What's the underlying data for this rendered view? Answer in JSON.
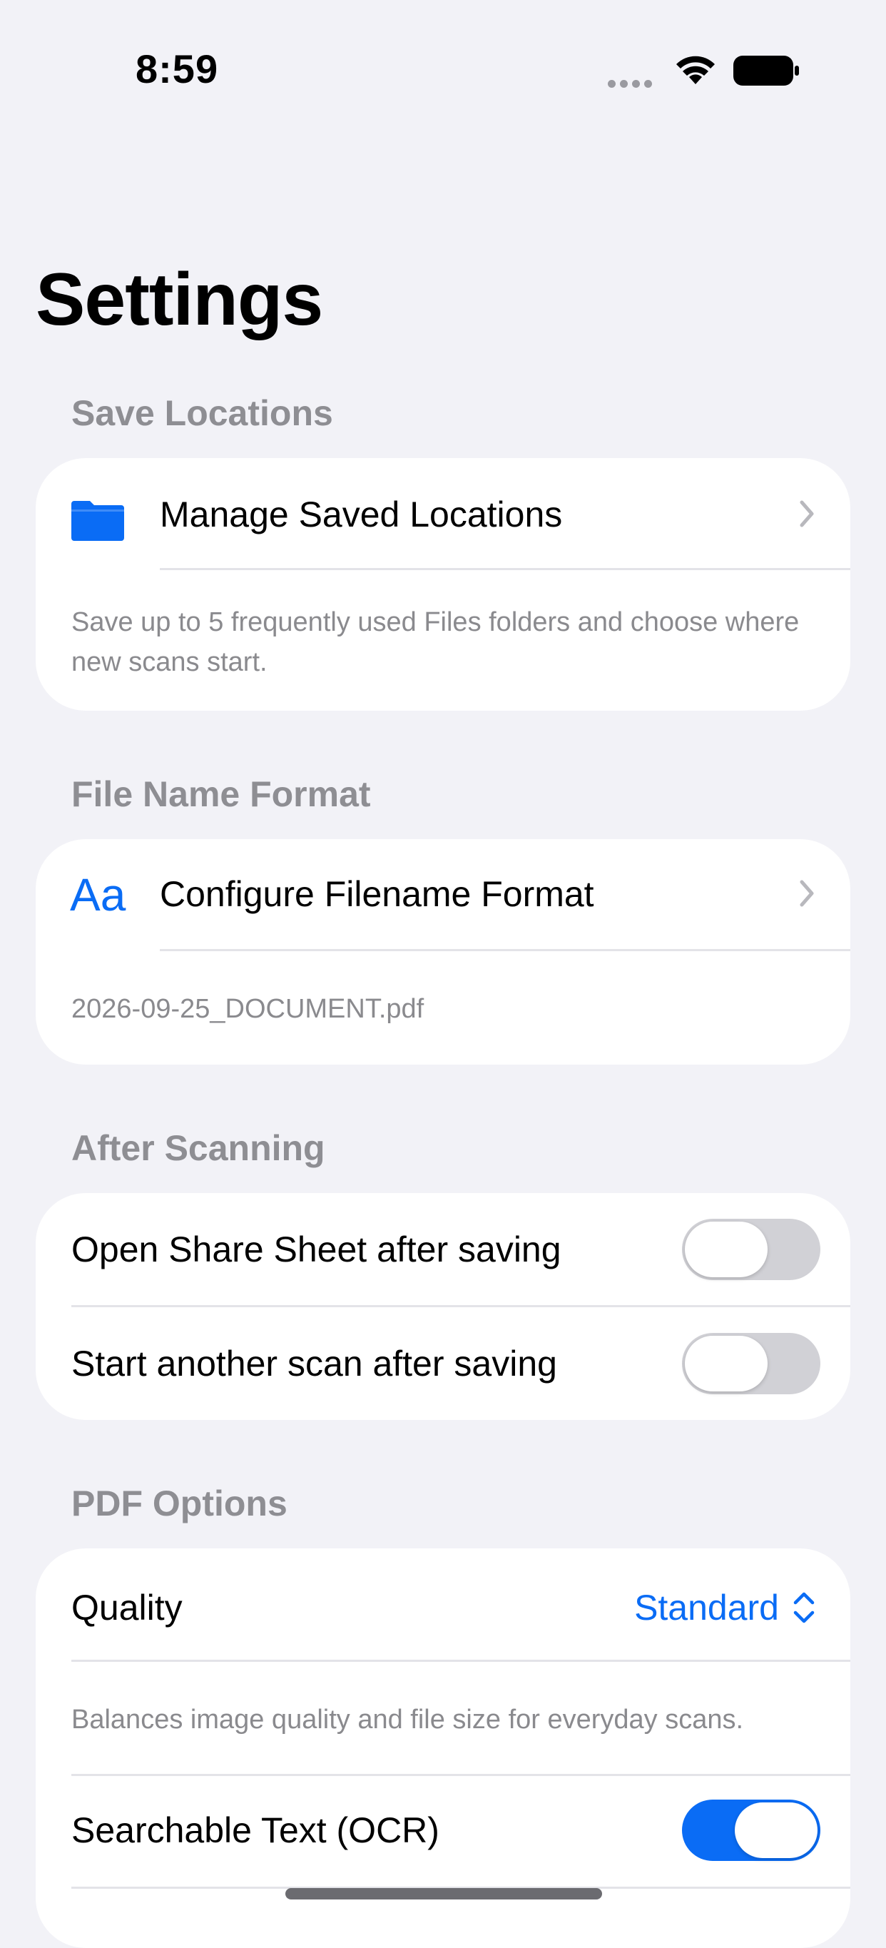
{
  "status_bar": {
    "time": "8:59"
  },
  "title": "Settings",
  "sections": {
    "save_locations": {
      "header": "Save Locations",
      "row_label": "Manage Saved Locations",
      "footnote": "Save up to 5 frequently used Files folders and choose where new scans start.",
      "icon": "folder-icon"
    },
    "file_name_format": {
      "header": "File Name Format",
      "row_label": "Configure Filename Format",
      "icon_text": "Aa",
      "example": "2026-09-25_DOCUMENT.pdf"
    },
    "after_scanning": {
      "header": "After Scanning",
      "rows": [
        {
          "label": "Open Share Sheet after saving",
          "on": false
        },
        {
          "label": "Start another scan after saving",
          "on": false
        }
      ]
    },
    "pdf_options": {
      "header": "PDF Options",
      "quality_label": "Quality",
      "quality_value": "Standard",
      "quality_footnote": "Balances image quality and file size for everyday scans.",
      "ocr_label": "Searchable Text (OCR)",
      "ocr_on": true
    }
  },
  "colors": {
    "accent": "#0a6cf5",
    "background": "#f2f2f7",
    "secondary_text": "#8e8e93"
  }
}
